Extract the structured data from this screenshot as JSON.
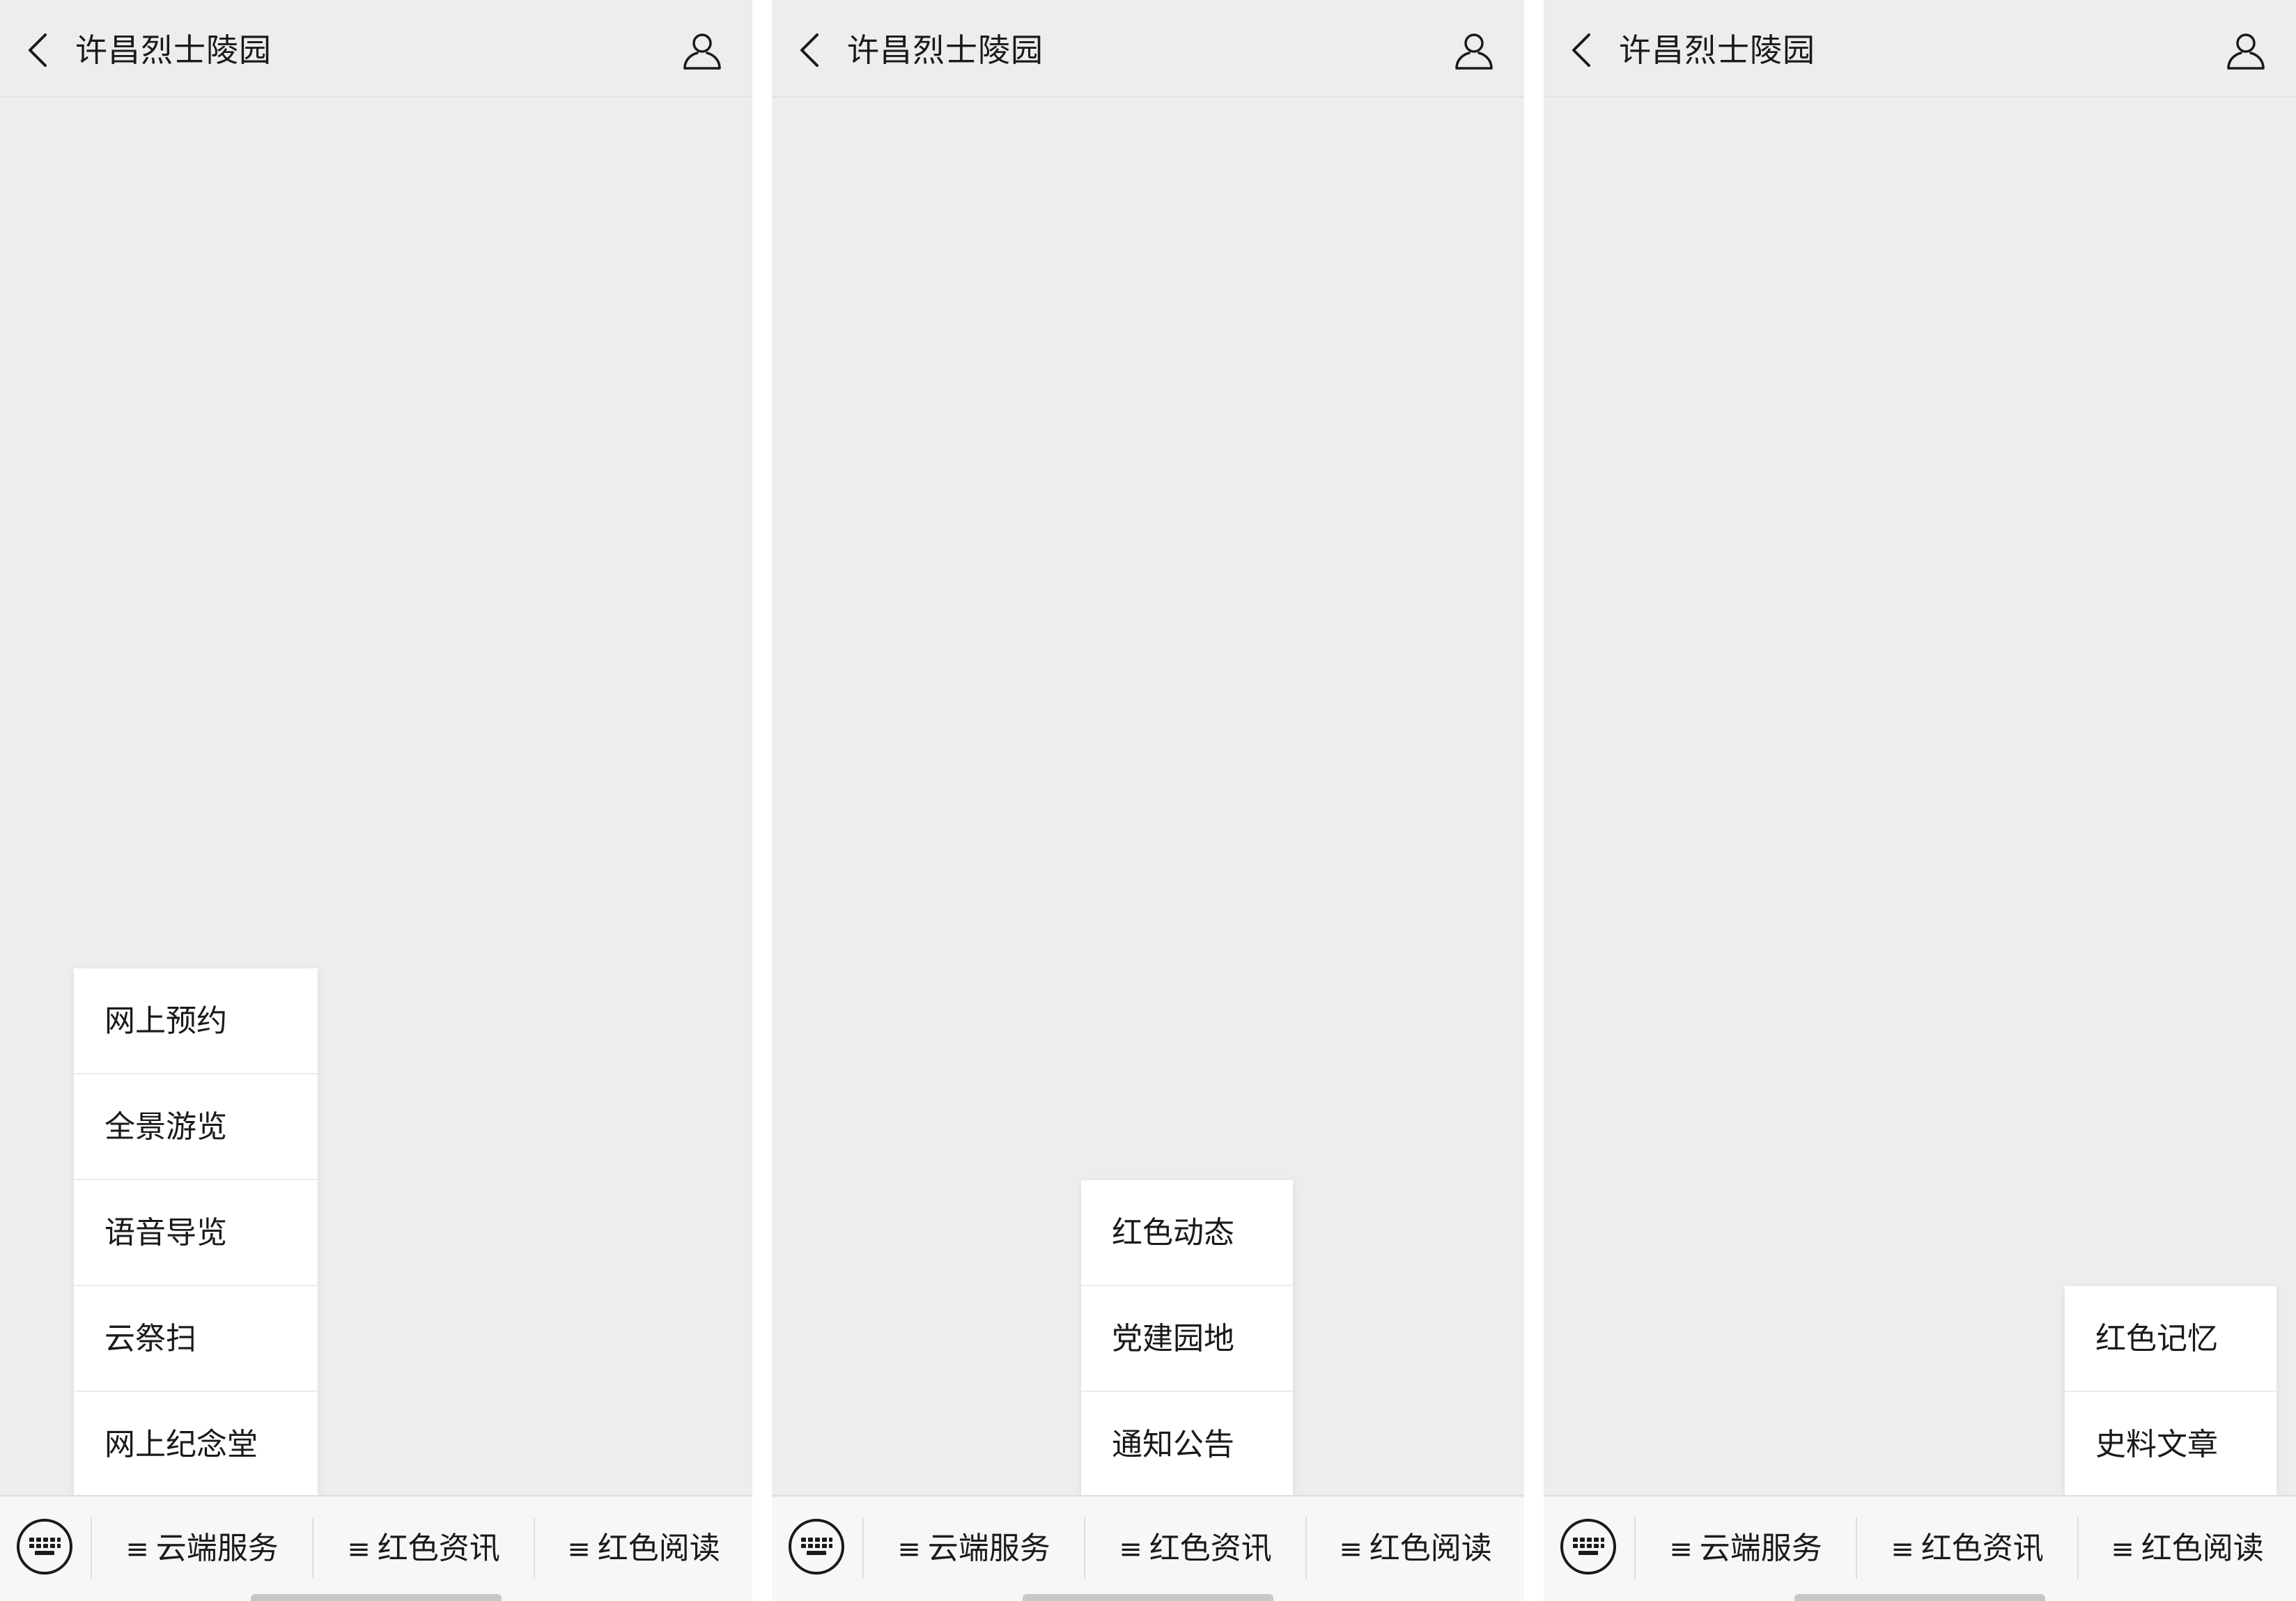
{
  "screens": [
    {
      "nav": {
        "title": "许昌烈士陵园"
      },
      "popup": {
        "items": [
          "网上预约",
          "全景游览",
          "语音导览",
          "云祭扫",
          "网上纪念堂"
        ]
      },
      "tabbar": {
        "tabs": [
          {
            "mark": "≡",
            "label": "云端服务"
          },
          {
            "mark": "≡",
            "label": "红色资讯"
          },
          {
            "mark": "≡",
            "label": "红色阅读"
          }
        ]
      }
    },
    {
      "nav": {
        "title": "许昌烈士陵园"
      },
      "popup": {
        "items": [
          "红色动态",
          "党建园地",
          "通知公告"
        ]
      },
      "tabbar": {
        "tabs": [
          {
            "mark": "≡",
            "label": "云端服务"
          },
          {
            "mark": "≡",
            "label": "红色资讯"
          },
          {
            "mark": "≡",
            "label": "红色阅读"
          }
        ]
      }
    },
    {
      "nav": {
        "title": "许昌烈士陵园"
      },
      "popup": {
        "items": [
          "红色记忆",
          "史料文章"
        ]
      },
      "tabbar": {
        "tabs": [
          {
            "mark": "≡",
            "label": "云端服务"
          },
          {
            "mark": "≡",
            "label": "红色资讯"
          },
          {
            "mark": "≡",
            "label": "红色阅读"
          }
        ]
      }
    }
  ],
  "icons": {
    "back": "chevron-left-icon",
    "profile": "user-icon",
    "keyboard": "keyboard-icon"
  },
  "colors": {
    "page_background": "#ededed",
    "menu_background": "#ffffff",
    "tabbar_background": "#f7f7f7",
    "text": "#1a1a1a"
  }
}
